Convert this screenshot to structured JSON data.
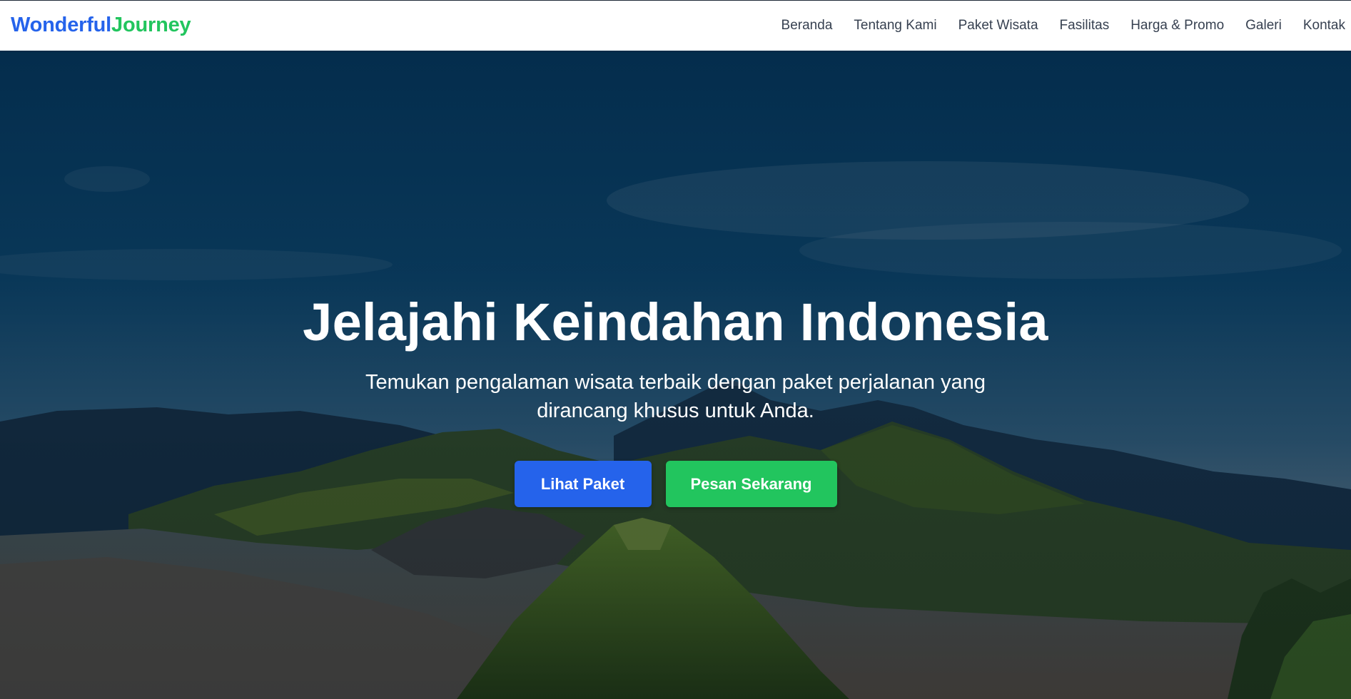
{
  "navbar": {
    "brand_part1": "Wonderful",
    "brand_part2": "Journey",
    "links": [
      "Beranda",
      "Tentang Kami",
      "Paket Wisata",
      "Fasilitas",
      "Harga & Promo",
      "Galeri",
      "Kontak"
    ]
  },
  "hero": {
    "title": "Jelajahi Keindahan Indonesia",
    "subtitle": "Temukan pengalaman wisata terbaik dengan paket perjalanan yang dirancang khusus untuk Anda.",
    "primary_button": "Lihat Paket",
    "secondary_button": "Pesan Sekarang"
  },
  "colors": {
    "brand_blue": "#2563eb",
    "brand_green": "#22c55e",
    "nav_text": "#374151"
  }
}
